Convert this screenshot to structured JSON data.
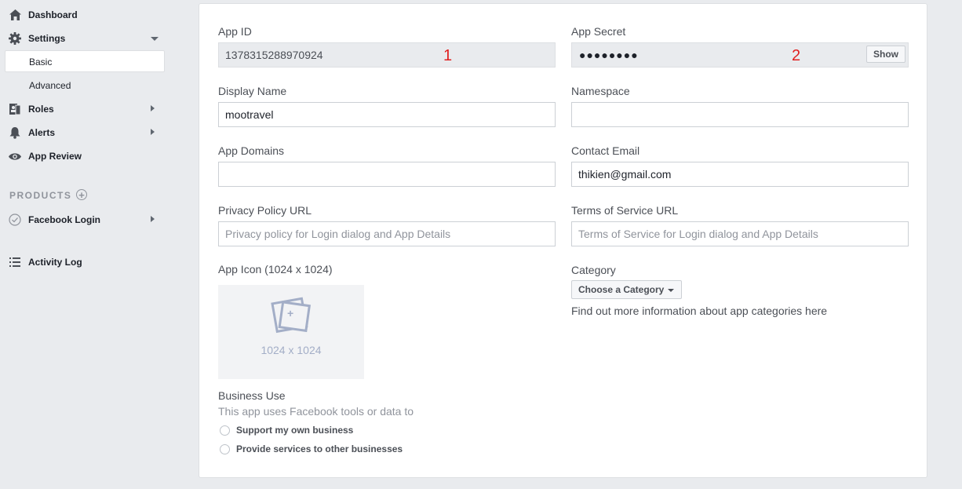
{
  "sidebar": {
    "dashboard": "Dashboard",
    "settings": "Settings",
    "basic": "Basic",
    "advanced": "Advanced",
    "roles": "Roles",
    "alerts": "Alerts",
    "app_review": "App Review",
    "products": "PRODUCTS",
    "products_add": "+",
    "facebook_login": "Facebook Login",
    "activity_log": "Activity Log"
  },
  "form": {
    "app_id_label": "App ID",
    "app_id_value": "1378315288970924",
    "app_id_marker": "1",
    "app_secret_label": "App Secret",
    "app_secret_value": "●●●●●●●●",
    "app_secret_marker": "2",
    "show_label": "Show",
    "display_name_label": "Display Name",
    "display_name_value": "mootravel",
    "namespace_label": "Namespace",
    "namespace_value": "",
    "app_domains_label": "App Domains",
    "app_domains_value": "",
    "contact_email_label": "Contact Email",
    "contact_email_value": "thikien@gmail.com",
    "privacy_label": "Privacy Policy URL",
    "privacy_placeholder": "Privacy policy for Login dialog and App Details",
    "terms_label": "Terms of Service URL",
    "terms_placeholder": "Terms of Service for Login dialog and App Details",
    "app_icon_label": "App Icon (1024 x 1024)",
    "app_icon_dim": "1024 x 1024",
    "category_label": "Category",
    "category_button": "Choose a Category",
    "category_help": "Find out more information about app categories here",
    "business_use_label": "Business Use",
    "business_use_desc": "This app uses Facebook tools or data to",
    "radio_own": "Support my own business",
    "radio_services": "Provide services to other businesses"
  }
}
